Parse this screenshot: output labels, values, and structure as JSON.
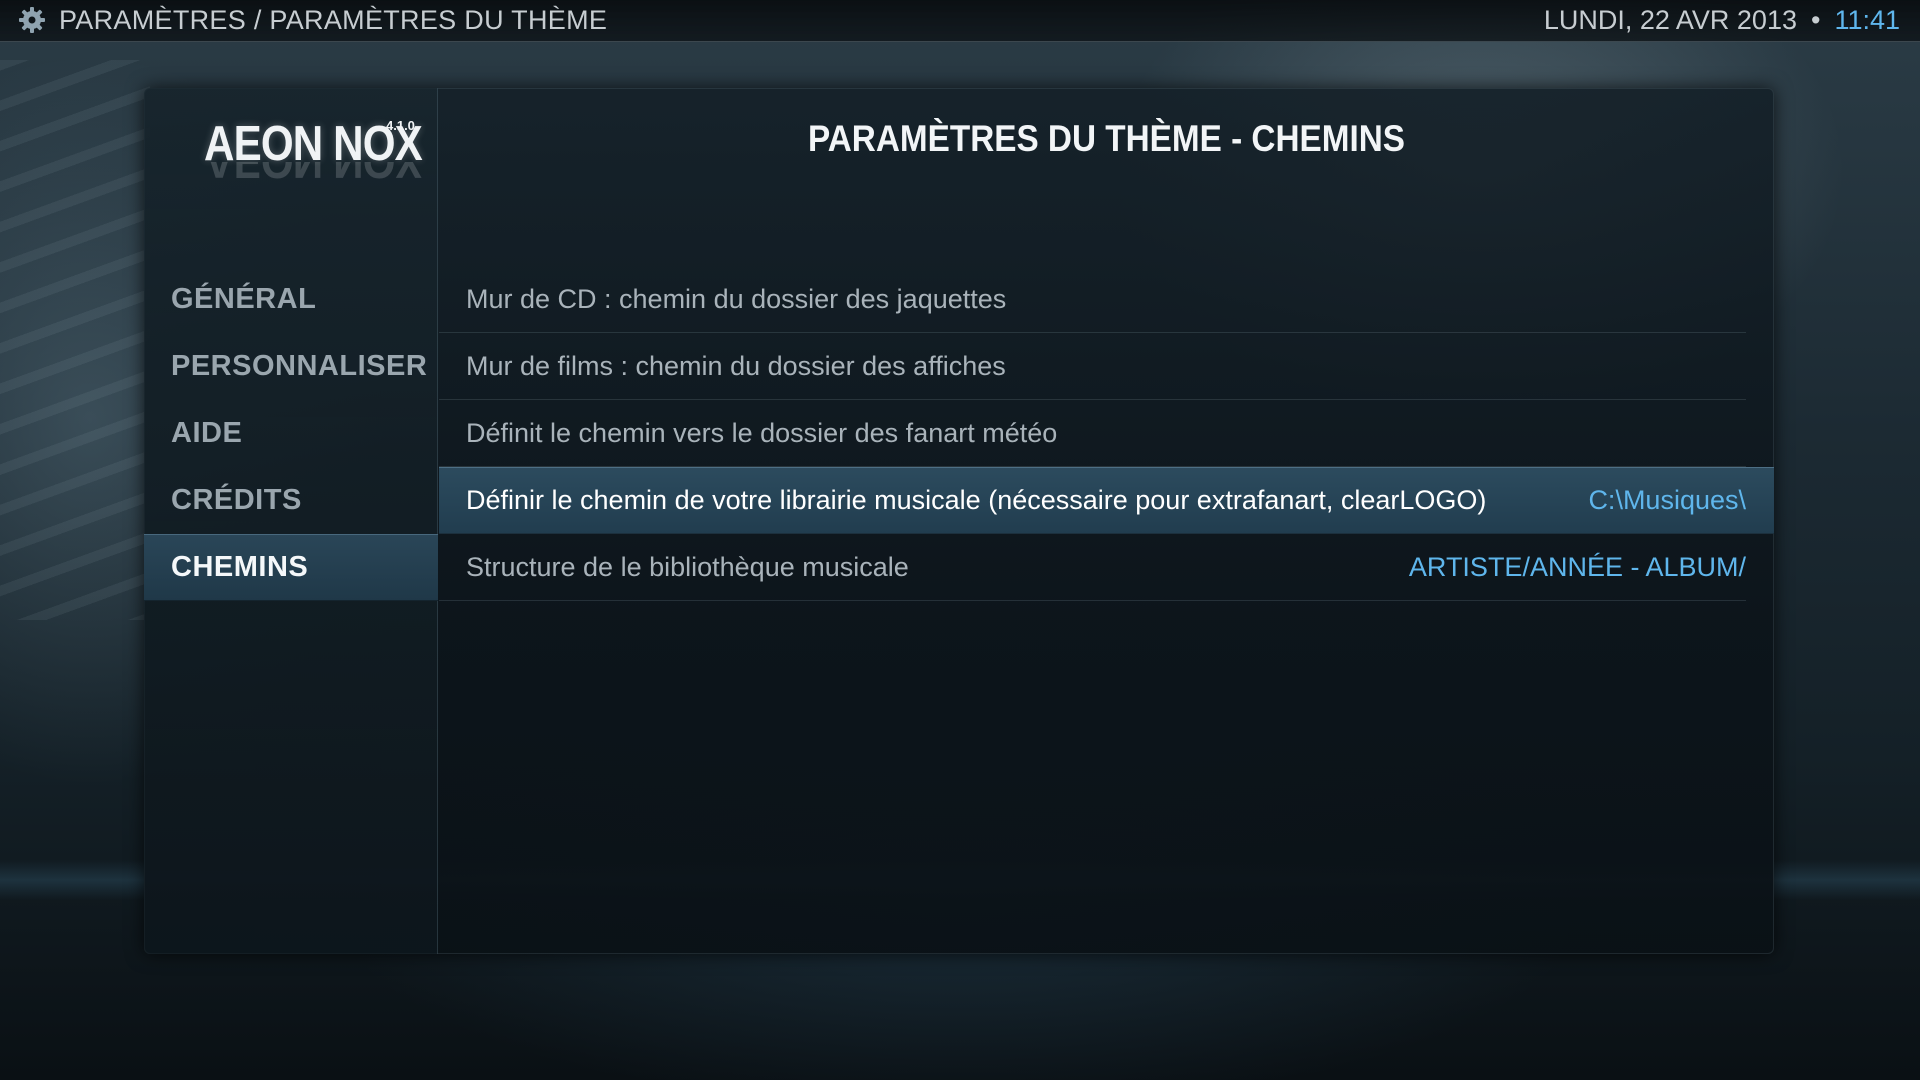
{
  "header": {
    "breadcrumb": "PARAMÈTRES / PARAMÈTRES DU THÈME",
    "date": "LUNDI, 22 AVR 2013",
    "separator": "•",
    "time": "11:41",
    "icon": "gear-icon"
  },
  "logo": {
    "text": "AEON NOX",
    "version": "4.1.0"
  },
  "sidebar": {
    "items": [
      {
        "label": "GÉNÉRAL",
        "active": false
      },
      {
        "label": "PERSONNALISER",
        "active": false
      },
      {
        "label": "AIDE",
        "active": false
      },
      {
        "label": "CRÉDITS",
        "active": false
      },
      {
        "label": "CHEMINS",
        "active": true
      }
    ]
  },
  "main": {
    "title": "PARAMÈTRES DU THÈME - CHEMINS",
    "settings": [
      {
        "label": "Mur de CD : chemin du dossier des jaquettes",
        "value": ""
      },
      {
        "label": "Mur de films : chemin du dossier des affiches",
        "value": ""
      },
      {
        "label": "Définit le chemin vers le dossier des fanart météo",
        "value": ""
      },
      {
        "label": "Définir le chemin de votre librairie musicale (nécessaire pour extrafanart, clearLOGO)",
        "value": "C:\\Musiques\\"
      },
      {
        "label": "Structure de le bibliothèque musicale",
        "value": "ARTISTE/ANNÉE - ALBUM/"
      }
    ]
  },
  "colors": {
    "accent": "#5fb6ec",
    "selection": "#2c4b5e",
    "panel": "#14202a"
  }
}
